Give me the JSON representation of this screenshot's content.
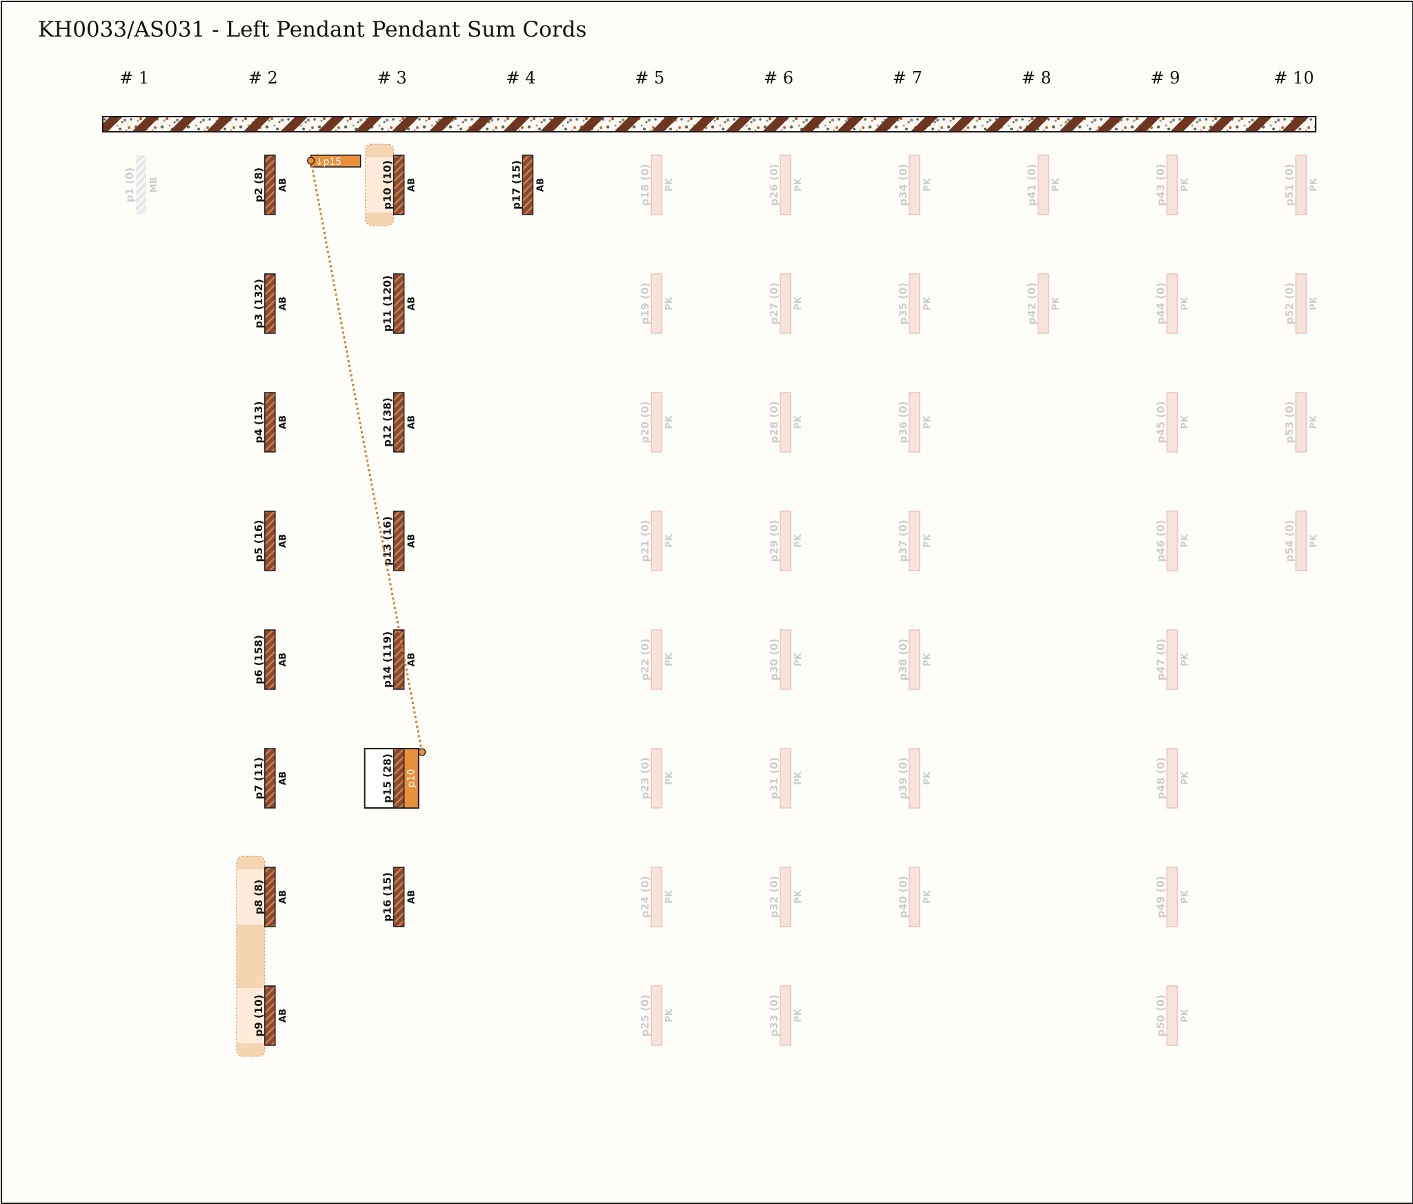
{
  "title": "KH0033/AS031 - Left Pendant Pendant Sum Cords",
  "groups": [
    "# 1",
    "# 2",
    "# 3",
    "# 4",
    "# 5",
    "# 6",
    "# 7",
    "# 8",
    "# 9",
    "# 10"
  ],
  "colors": {
    "background": "#fffdf7",
    "cord_brown": "#8b4a2b",
    "cord_stripe": "#c9805a",
    "faded_cord": "#f8e3dc",
    "faded_border": "#eac3b8",
    "faded_text": "#cdcdcd",
    "highlight_orange": "#e8903c",
    "band_light": "#fcecd9",
    "band_mid": "#f6d5b2"
  },
  "cords": [
    {
      "group": 1,
      "row": 1,
      "label": "p1 (0)",
      "color": "MB",
      "style": "ghost"
    },
    {
      "group": 2,
      "row": 1,
      "label": "p2 (8)",
      "color": "AB",
      "style": "active"
    },
    {
      "group": 2,
      "row": 2,
      "label": "p3 (132)",
      "color": "AB",
      "style": "active"
    },
    {
      "group": 2,
      "row": 3,
      "label": "p4 (13)",
      "color": "AB",
      "style": "active"
    },
    {
      "group": 2,
      "row": 4,
      "label": "p5 (16)",
      "color": "AB",
      "style": "active"
    },
    {
      "group": 2,
      "row": 5,
      "label": "p6 (158)",
      "color": "AB",
      "style": "active"
    },
    {
      "group": 2,
      "row": 6,
      "label": "p7 (11)",
      "color": "AB",
      "style": "active"
    },
    {
      "group": 2,
      "row": 7,
      "label": "p8 (8)",
      "color": "AB",
      "style": "active"
    },
    {
      "group": 2,
      "row": 8,
      "label": "p9 (10)",
      "color": "AB",
      "style": "active"
    },
    {
      "group": 3,
      "row": 1,
      "label": "p10 (10)",
      "color": "AB",
      "style": "active"
    },
    {
      "group": 3,
      "row": 2,
      "label": "p11 (120)",
      "color": "AB",
      "style": "active"
    },
    {
      "group": 3,
      "row": 3,
      "label": "p12 (38)",
      "color": "AB",
      "style": "active"
    },
    {
      "group": 3,
      "row": 4,
      "label": "p13 (16)",
      "color": "AB",
      "style": "active"
    },
    {
      "group": 3,
      "row": 5,
      "label": "p14 (119)",
      "color": "AB",
      "style": "active"
    },
    {
      "group": 3,
      "row": 6,
      "label": "p15 (28)",
      "color": "AB",
      "style": "active"
    },
    {
      "group": 3,
      "row": 7,
      "label": "p16 (15)",
      "color": "AB",
      "style": "active"
    },
    {
      "group": 4,
      "row": 1,
      "label": "p17 (15)",
      "color": "AB",
      "style": "active"
    },
    {
      "group": 5,
      "row": 1,
      "label": "p18 (0)",
      "color": "PK",
      "style": "faded"
    },
    {
      "group": 5,
      "row": 2,
      "label": "p19 (0)",
      "color": "PK",
      "style": "faded"
    },
    {
      "group": 5,
      "row": 3,
      "label": "p20 (0)",
      "color": "PK",
      "style": "faded"
    },
    {
      "group": 5,
      "row": 4,
      "label": "p21 (0)",
      "color": "PK",
      "style": "faded"
    },
    {
      "group": 5,
      "row": 5,
      "label": "p22 (0)",
      "color": "PK",
      "style": "faded"
    },
    {
      "group": 5,
      "row": 6,
      "label": "p23 (0)",
      "color": "PK",
      "style": "faded"
    },
    {
      "group": 5,
      "row": 7,
      "label": "p24 (0)",
      "color": "PK",
      "style": "faded"
    },
    {
      "group": 5,
      "row": 8,
      "label": "p25 (0)",
      "color": "PK",
      "style": "faded"
    },
    {
      "group": 6,
      "row": 1,
      "label": "p26 (0)",
      "color": "PK",
      "style": "faded"
    },
    {
      "group": 6,
      "row": 2,
      "label": "p27 (0)",
      "color": "PK",
      "style": "faded"
    },
    {
      "group": 6,
      "row": 3,
      "label": "p28 (0)",
      "color": "PK",
      "style": "faded"
    },
    {
      "group": 6,
      "row": 4,
      "label": "p29 (0)",
      "color": "PK",
      "style": "faded"
    },
    {
      "group": 6,
      "row": 5,
      "label": "p30 (0)",
      "color": "PK",
      "style": "faded"
    },
    {
      "group": 6,
      "row": 6,
      "label": "p31 (0)",
      "color": "PK",
      "style": "faded"
    },
    {
      "group": 6,
      "row": 7,
      "label": "p32 (0)",
      "color": "PK",
      "style": "faded"
    },
    {
      "group": 6,
      "row": 8,
      "label": "p33 (0)",
      "color": "PK",
      "style": "faded"
    },
    {
      "group": 7,
      "row": 1,
      "label": "p34 (0)",
      "color": "PK",
      "style": "faded"
    },
    {
      "group": 7,
      "row": 2,
      "label": "p35 (0)",
      "color": "PK",
      "style": "faded"
    },
    {
      "group": 7,
      "row": 3,
      "label": "p36 (0)",
      "color": "PK",
      "style": "faded"
    },
    {
      "group": 7,
      "row": 4,
      "label": "p37 (0)",
      "color": "PK",
      "style": "faded"
    },
    {
      "group": 7,
      "row": 5,
      "label": "p38 (0)",
      "color": "PK",
      "style": "faded"
    },
    {
      "group": 7,
      "row": 6,
      "label": "p39 (0)",
      "color": "PK",
      "style": "faded"
    },
    {
      "group": 7,
      "row": 7,
      "label": "p40 (0)",
      "color": "PK",
      "style": "faded"
    },
    {
      "group": 8,
      "row": 1,
      "label": "p41 (0)",
      "color": "PK",
      "style": "faded"
    },
    {
      "group": 8,
      "row": 2,
      "label": "p42 (0)",
      "color": "PK",
      "style": "faded"
    },
    {
      "group": 9,
      "row": 1,
      "label": "p43 (0)",
      "color": "PK",
      "style": "faded"
    },
    {
      "group": 9,
      "row": 2,
      "label": "p44 (0)",
      "color": "PK",
      "style": "faded"
    },
    {
      "group": 9,
      "row": 3,
      "label": "p45 (0)",
      "color": "PK",
      "style": "faded"
    },
    {
      "group": 9,
      "row": 4,
      "label": "p46 (0)",
      "color": "PK",
      "style": "faded"
    },
    {
      "group": 9,
      "row": 5,
      "label": "p47 (0)",
      "color": "PK",
      "style": "faded"
    },
    {
      "group": 9,
      "row": 6,
      "label": "p48 (0)",
      "color": "PK",
      "style": "faded"
    },
    {
      "group": 9,
      "row": 7,
      "label": "p49 (0)",
      "color": "PK",
      "style": "faded"
    },
    {
      "group": 9,
      "row": 8,
      "label": "p50 (0)",
      "color": "PK",
      "style": "faded"
    },
    {
      "group": 10,
      "row": 1,
      "label": "p51 (0)",
      "color": "PK",
      "style": "faded"
    },
    {
      "group": 10,
      "row": 2,
      "label": "p52 (0)",
      "color": "PK",
      "style": "faded"
    },
    {
      "group": 10,
      "row": 3,
      "label": "p53 (0)",
      "color": "PK",
      "style": "faded"
    },
    {
      "group": 10,
      "row": 4,
      "label": "p54 (0)",
      "color": "PK",
      "style": "faded"
    }
  ],
  "bands": [
    {
      "group": 2,
      "from_row": 7,
      "to_row": 8
    },
    {
      "group": 3,
      "from_row": 1,
      "to_row": 1
    }
  ],
  "sum_links": [
    {
      "from_cord": "p10 (10)",
      "to_cord": "p15 (28)",
      "from_tag": "↓p15",
      "to_tag": "p10"
    }
  ],
  "selected_cord": "p15 (28)"
}
